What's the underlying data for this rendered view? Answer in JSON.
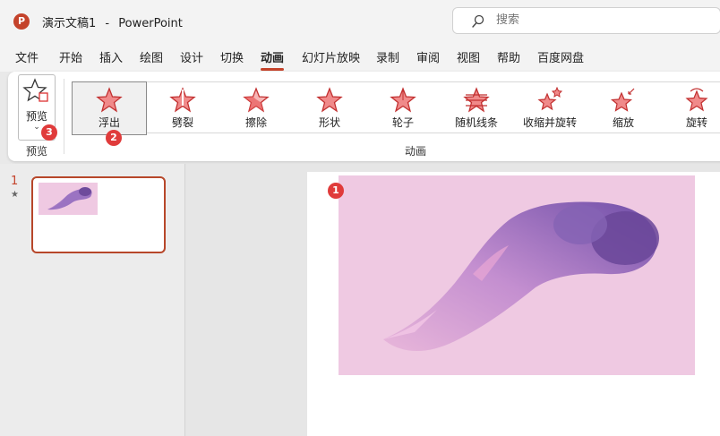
{
  "titlebar": {
    "logo": "P",
    "doc_title": "演示文稿1",
    "separator": "-",
    "app_name": "PowerPoint",
    "search_placeholder": "搜索"
  },
  "menu": {
    "tabs": [
      {
        "label": "文件"
      },
      {
        "label": "开始"
      },
      {
        "label": "插入"
      },
      {
        "label": "绘图"
      },
      {
        "label": "设计"
      },
      {
        "label": "切换"
      },
      {
        "label": "动画",
        "active": true
      },
      {
        "label": "幻灯片放映"
      },
      {
        "label": "录制"
      },
      {
        "label": "审阅"
      },
      {
        "label": "视图"
      },
      {
        "label": "帮助"
      },
      {
        "label": "百度网盘"
      }
    ]
  },
  "ribbon": {
    "preview_button": "预览",
    "preview_group": "预览",
    "animation_group": "动画",
    "animations": [
      {
        "label": "浮出",
        "selected": true
      },
      {
        "label": "劈裂"
      },
      {
        "label": "擦除"
      },
      {
        "label": "形状"
      },
      {
        "label": "轮子"
      },
      {
        "label": "随机线条"
      },
      {
        "label": "收缩并旋转"
      },
      {
        "label": "缩放"
      },
      {
        "label": "旋转"
      }
    ]
  },
  "badges": {
    "slide": "1",
    "float_in": "2",
    "preview": "3"
  },
  "thumbnails": {
    "slide_number": "1",
    "animation_marker": "★"
  },
  "colors": {
    "accent": "#c4432b",
    "star_fill": "#e86a6a",
    "badge": "#e03b3b",
    "image_bg": "#efc9e2"
  },
  "icons": {
    "search": "search-icon",
    "preview": "star-preview-icon",
    "animation": "star-icon"
  }
}
